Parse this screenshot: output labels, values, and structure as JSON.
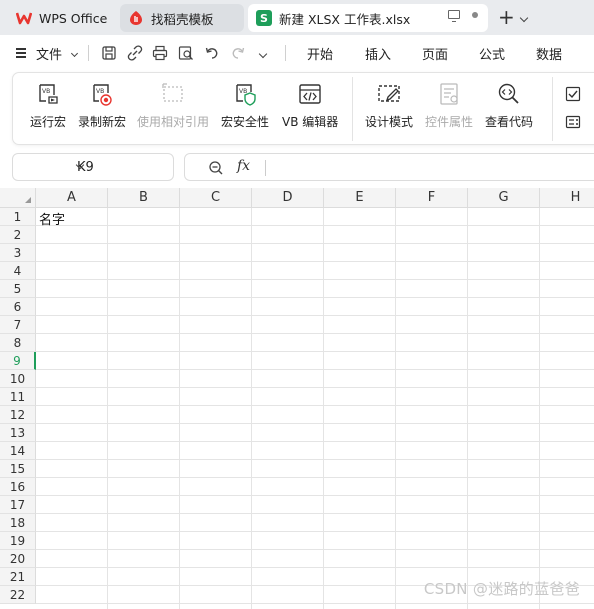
{
  "tabs": {
    "wps_label": "WPS Office",
    "find_label": "找稻壳模板",
    "doc_label": "新建 XLSX 工作表.xlsx",
    "doc_icon_letter": "S"
  },
  "menu": {
    "file": "文件",
    "start": "开始",
    "insert": "插入",
    "page": "页面",
    "formula": "公式",
    "data": "数据"
  },
  "ribbon": {
    "run_macro": "运行宏",
    "record_macro": "录制新宏",
    "relative_ref": "使用相对引用",
    "macro_security": "宏安全性",
    "vb_editor": "VB 编辑器",
    "design_mode": "设计模式",
    "control_props": "控件属性",
    "view_code": "查看代码"
  },
  "formula_bar": {
    "name_box": "K9",
    "fx": "fx"
  },
  "sheet": {
    "columns": [
      "A",
      "B",
      "C",
      "D",
      "E",
      "F",
      "G",
      "H"
    ],
    "rows": [
      "1",
      "2",
      "3",
      "4",
      "5",
      "6",
      "7",
      "8",
      "9",
      "10",
      "11",
      "12",
      "13",
      "14",
      "15",
      "16",
      "17",
      "18",
      "19",
      "20",
      "21",
      "22"
    ],
    "active_row": "9",
    "cell_A1": "名字"
  },
  "watermark": "CSDN @迷路的蓝爸爸",
  "colors": {
    "accent": "#1e9e5a",
    "wps_red": "#e8352f"
  }
}
